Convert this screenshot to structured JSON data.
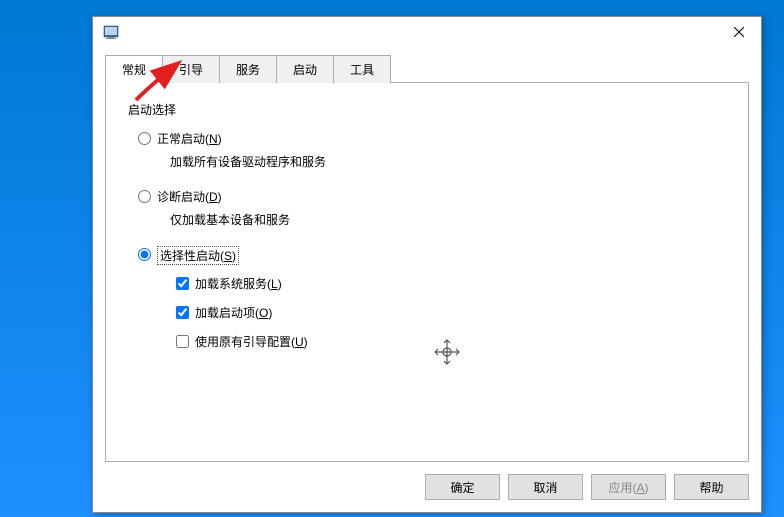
{
  "tabs": {
    "general": "常规",
    "boot": "引导",
    "services": "服务",
    "startup": "启动",
    "tools": "工具"
  },
  "group": {
    "label": "启动选择"
  },
  "normal": {
    "label": "正常启动(N)",
    "desc": "加载所有设备驱动程序和服务"
  },
  "diagnostic": {
    "label": "诊断启动(D)",
    "desc": "仅加载基本设备和服务"
  },
  "selective": {
    "label": "选择性启动(S)"
  },
  "checks": {
    "load_services": "加载系统服务(L)",
    "load_startup": "加载启动项(O)",
    "original_boot": "使用原有引导配置(U)"
  },
  "buttons": {
    "ok": "确定",
    "cancel": "取消",
    "apply": "应用(A)",
    "help": "帮助"
  }
}
